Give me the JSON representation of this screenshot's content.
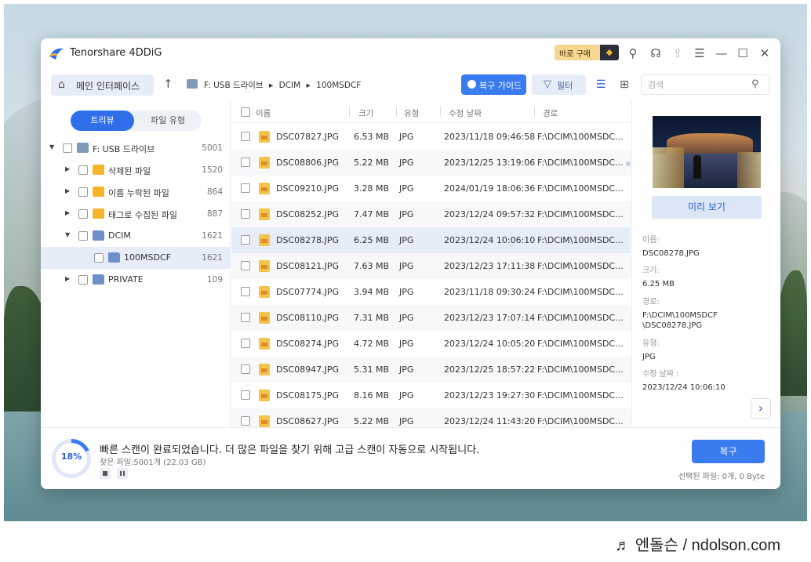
{
  "app": {
    "title": "Tenorshare 4DDiG"
  },
  "titlebar": {
    "buy_label": "바로 구매",
    "icons": [
      "diamond-icon",
      "broom-icon",
      "headset-icon",
      "share-icon",
      "menu-icon",
      "minimize-icon",
      "maximize-icon",
      "close-icon"
    ],
    "icon_glyphs": {
      "minimize": "—",
      "maximize": "☐",
      "close": "✕",
      "menu": "☰",
      "headset": "☊",
      "share": "⇪",
      "broom": "⚲"
    }
  },
  "toolbar": {
    "home_label": "메인 인터페이스",
    "breadcrumb": [
      "F: USB 드라이브",
      "DCIM",
      "100MSDCF"
    ],
    "guide_label": "복구 가이드",
    "filter_label": "필터",
    "search_placeholder": "검색"
  },
  "sidebar": {
    "tabs": [
      "트리뷰",
      "파일 유형"
    ],
    "active_tab": "트리뷰",
    "tree": [
      {
        "label": "F: USB 드라이브",
        "count": "5001",
        "expanded": true,
        "icon": "drive-icon"
      },
      {
        "label": "삭제된 파일",
        "count": "1520",
        "expanded": false,
        "icon": "deleted-folder-icon"
      },
      {
        "label": "이름 누락된 파일",
        "count": "864",
        "expanded": false,
        "icon": "unnamed-folder-icon"
      },
      {
        "label": "태그로 수집된 파일",
        "count": "887",
        "expanded": false,
        "icon": "tagged-folder-icon"
      },
      {
        "label": "DCIM",
        "count": "1621",
        "expanded": true,
        "icon": "folder-icon"
      },
      {
        "label": "100MSDCF",
        "count": "1621",
        "selected": true,
        "icon": "folder-icon"
      },
      {
        "label": "PRIVATE",
        "count": "109",
        "expanded": false,
        "icon": "folder-icon"
      }
    ]
  },
  "table": {
    "columns": [
      "이름",
      "크기",
      "유형",
      "수정 날짜",
      "경로"
    ],
    "selected_row": 4,
    "rows": [
      {
        "name": "DSC07827.JPG",
        "size": "6.53 MB",
        "type": "JPG",
        "date": "2023/11/18 09:46:58",
        "path": "F:\\DCIM\\100MSDC..."
      },
      {
        "name": "DSC08806.JPG",
        "size": "5.22 MB",
        "type": "JPG",
        "date": "2023/12/25 13:19:06",
        "path": "F:\\DCIM\\100MSDC..."
      },
      {
        "name": "DSC09210.JPG",
        "size": "3.28 MB",
        "type": "JPG",
        "date": "2024/01/19 18:06:36",
        "path": "F:\\DCIM\\100MSDC..."
      },
      {
        "name": "DSC08252.JPG",
        "size": "7.47 MB",
        "type": "JPG",
        "date": "2023/12/24 09:57:32",
        "path": "F:\\DCIM\\100MSDC..."
      },
      {
        "name": "DSC08278.JPG",
        "size": "6.25 MB",
        "type": "JPG",
        "date": "2023/12/24 10:06:10",
        "path": "F:\\DCIM\\100MSDC..."
      },
      {
        "name": "DSC08121.JPG",
        "size": "7.63 MB",
        "type": "JPG",
        "date": "2023/12/23 17:11:38",
        "path": "F:\\DCIM\\100MSDC..."
      },
      {
        "name": "DSC07774.JPG",
        "size": "3.94 MB",
        "type": "JPG",
        "date": "2023/11/18 09:30:24",
        "path": "F:\\DCIM\\100MSDC..."
      },
      {
        "name": "DSC08110.JPG",
        "size": "7.31 MB",
        "type": "JPG",
        "date": "2023/12/23 17:07:14",
        "path": "F:\\DCIM\\100MSDC..."
      },
      {
        "name": "DSC08274.JPG",
        "size": "4.72 MB",
        "type": "JPG",
        "date": "2023/12/24 10:05:20",
        "path": "F:\\DCIM\\100MSDC..."
      },
      {
        "name": "DSC08947.JPG",
        "size": "5.31 MB",
        "type": "JPG",
        "date": "2023/12/25 18:57:22",
        "path": "F:\\DCIM\\100MSDC..."
      },
      {
        "name": "DSC08175.JPG",
        "size": "8.16 MB",
        "type": "JPG",
        "date": "2023/12/23 19:27:30",
        "path": "F:\\DCIM\\100MSDC..."
      },
      {
        "name": "DSC08627.JPG",
        "size": "5.22 MB",
        "type": "JPG",
        "date": "2023/12/24 11:43:20",
        "path": "F:\\DCIM\\100MSDC..."
      }
    ]
  },
  "preview": {
    "button_label": "미리 보기",
    "fields": [
      {
        "key": "이름:",
        "value": "DSC08278.JPG"
      },
      {
        "key": "크기:",
        "value": "6.25 MB"
      },
      {
        "key": "경로:",
        "value": "F:\\DCIM\\100MSDCF\n\\DSC08278.JPG"
      },
      {
        "key": "유형:",
        "value": "JPG"
      },
      {
        "key": "수정 날짜 :",
        "value": "2023/12/24 10:06:10"
      }
    ]
  },
  "status": {
    "progress_percent": 18,
    "progress_label": "18%",
    "message": "빠른 스캔이 완료되었습니다. 더 많은 파일을 찾기 위해 고급 스캔이 자동으로 시작됩니다.",
    "found": "찾은 파일:5001개 (22.03 GB)",
    "recover_label": "복구",
    "selected_info": "선택된 파일: 0개, 0 Byte"
  },
  "watermark": {
    "text": "♬ 엔돌슨 / ndolson.com"
  },
  "colors": {
    "accent": "#3a7bef",
    "selected_row": "#e6ecf8",
    "buy_badge": "#f7d890"
  }
}
